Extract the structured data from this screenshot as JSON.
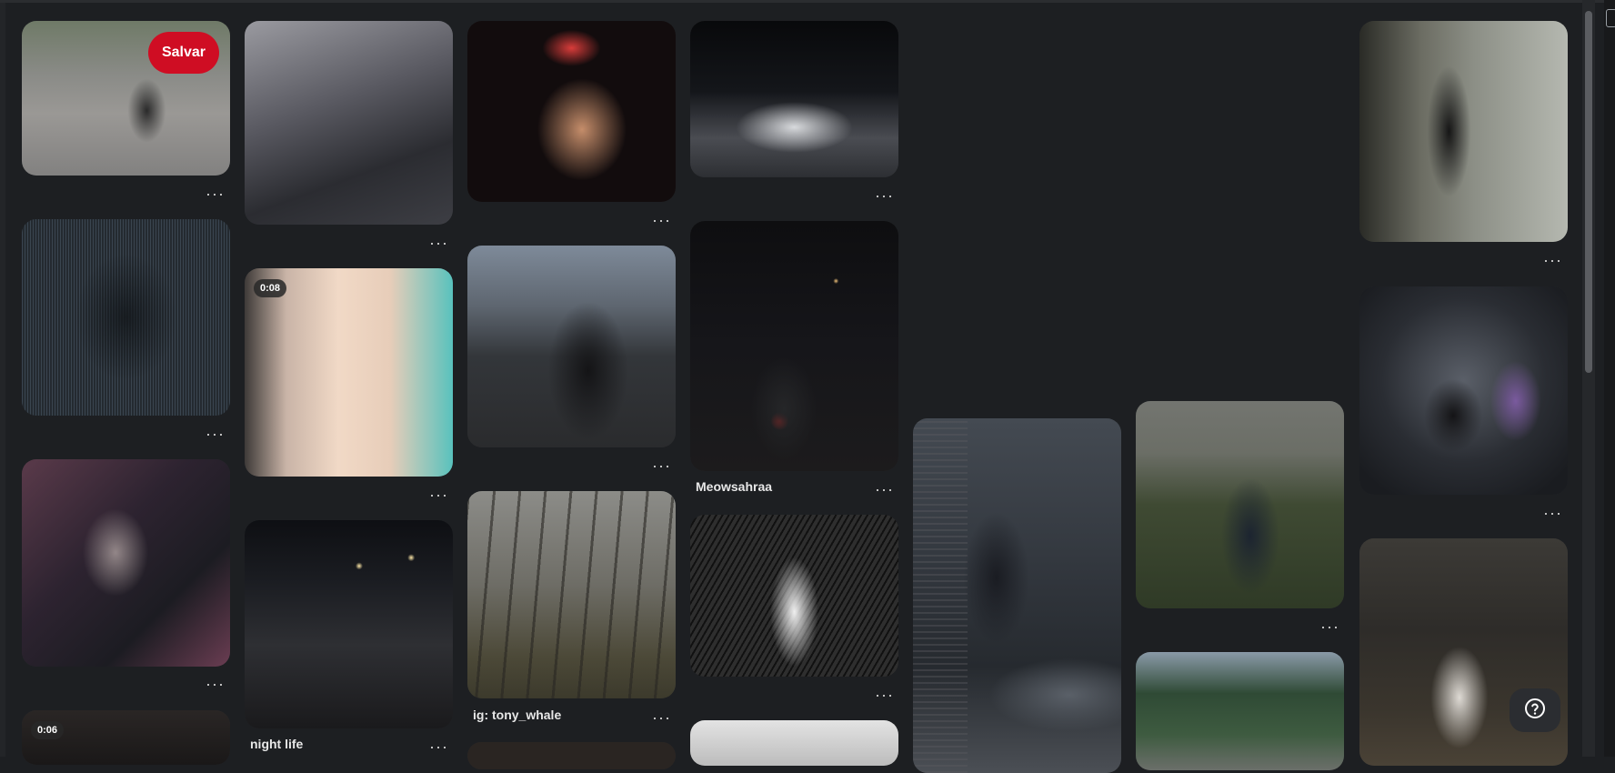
{
  "save_label": "Salvar",
  "more_label": "···",
  "help_icon": "question-circle-icon",
  "colors": {
    "background": "#1d1f22",
    "save": "#cf0d23"
  },
  "pins": [
    {
      "name": "witch-graffiti",
      "badge": "",
      "caption": ""
    },
    {
      "name": "ascii-portrait",
      "badge": "",
      "caption": ""
    },
    {
      "name": "goth-girl-selfie",
      "badge": "",
      "caption": ""
    },
    {
      "name": "video-pin-1",
      "badge": "0:06",
      "caption": ""
    },
    {
      "name": "girl-with-mug",
      "badge": "",
      "caption": ""
    },
    {
      "name": "flip-phone-video",
      "badge": "0:08",
      "caption": ""
    },
    {
      "name": "night-life",
      "badge": "",
      "caption": "night life"
    },
    {
      "name": "violin-meme",
      "badge": "",
      "caption": ""
    },
    {
      "name": "hooded-figure-field",
      "badge": "",
      "caption": ""
    },
    {
      "name": "forest-walk",
      "badge": "",
      "caption": "ig: tony_whale"
    },
    {
      "name": "white-car-night",
      "badge": "",
      "caption": ""
    },
    {
      "name": "girl-by-lake-night",
      "badge": "",
      "caption": "Meowsahraa"
    },
    {
      "name": "dark-anime-drawing",
      "badge": "",
      "caption": ""
    },
    {
      "name": "snow-pin",
      "badge": "",
      "caption": ""
    },
    {
      "name": "anime-girl-car",
      "badge": "",
      "caption": ""
    },
    {
      "name": "graveyard-girl",
      "badge": "",
      "caption": ""
    },
    {
      "name": "forest-lying",
      "badge": "",
      "caption": ""
    },
    {
      "name": "abandoned-hallway",
      "badge": "",
      "caption": ""
    },
    {
      "name": "swing-girl",
      "badge": "",
      "caption": ""
    },
    {
      "name": "forest-crouch",
      "badge": "",
      "caption": ""
    }
  ]
}
